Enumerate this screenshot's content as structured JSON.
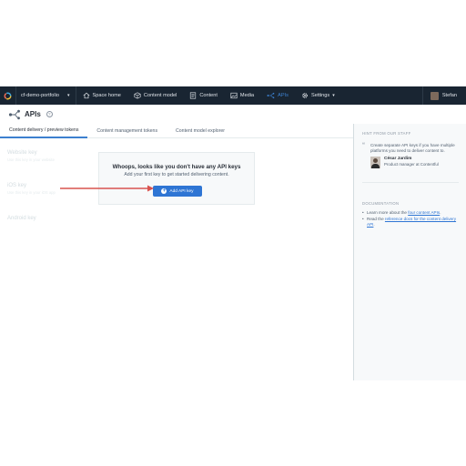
{
  "colors": {
    "nav_bg": "#192532",
    "accent": "#3c80cf",
    "button": "#2e75d4",
    "arrow": "#d9534f"
  },
  "nav": {
    "space_name": "cf-demo-portfolio",
    "items": [
      {
        "label": "Space home",
        "icon": "home-icon"
      },
      {
        "label": "Content model",
        "icon": "cube-icon"
      },
      {
        "label": "Content",
        "icon": "list-icon"
      },
      {
        "label": "Media",
        "icon": "image-icon"
      },
      {
        "label": "APIs",
        "icon": "api-icon"
      },
      {
        "label": "Settings",
        "icon": "gear-icon"
      }
    ],
    "user_name": "Stefan"
  },
  "header": {
    "title": "APIs",
    "help": "?"
  },
  "tabs": [
    "Content delivery / preview tokens",
    "Content management tokens",
    "Content model explorer"
  ],
  "keys": [
    {
      "name": "Website key",
      "desc": "Use this key in your website"
    },
    {
      "name": "iOS key",
      "desc": "Use this key in your iOS app"
    },
    {
      "name": "Android key",
      "desc": ""
    }
  ],
  "empty_state": {
    "title": "Whoops, looks like you don't have any API keys",
    "subtitle": "Add your first key to get started delivering content.",
    "button": "Add API key"
  },
  "sidebar": {
    "hint_heading": "HINT FROM OUR STAFF",
    "hint_text": "Create separate API keys if you have multiple platforms you need to deliver content to.",
    "staff_name": "César Jardim",
    "staff_role": "Product manager at Contentful",
    "doc_heading": "DOCUMENTATION",
    "doc1_pre": "Learn more about the ",
    "doc1_link": "four content APIs",
    "doc1_post": ".",
    "doc2_pre": "Read the ",
    "doc2_link": "reference docs for the content delivery API",
    "doc2_post": "."
  }
}
